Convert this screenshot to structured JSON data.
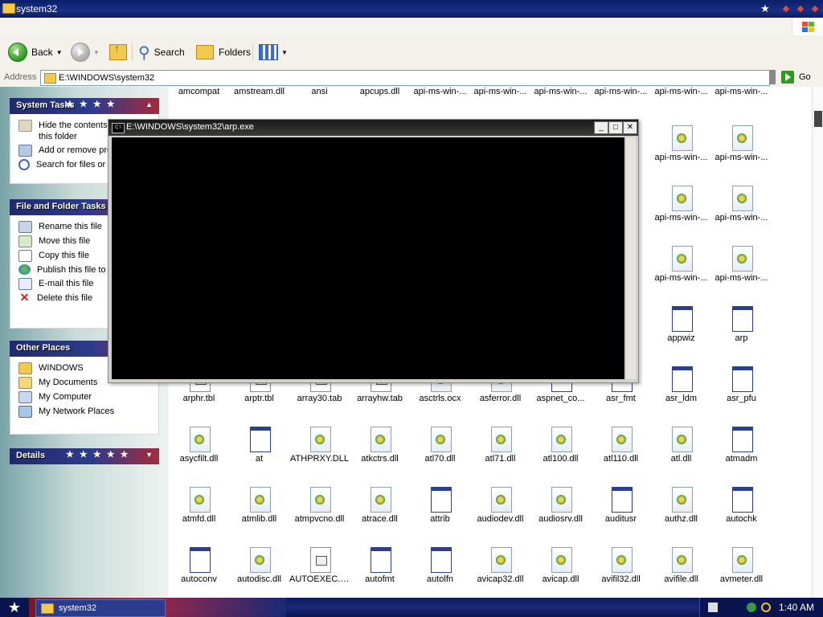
{
  "window": {
    "title": "system32",
    "path": "E:\\WINDOWS\\system32"
  },
  "toolbar": {
    "back": "Back",
    "search": "Search",
    "folders": "Folders"
  },
  "address": {
    "label": "Address",
    "value": "E:\\WINDOWS\\system32",
    "go": "Go"
  },
  "tasks": {
    "system": {
      "title": "System Tasks",
      "items": [
        "Hide the contents of this folder",
        "Add or remove programs",
        "Search for files or folders"
      ]
    },
    "file": {
      "title": "File and Folder Tasks",
      "items": [
        "Rename this file",
        "Move this file",
        "Copy this file",
        "Publish this file to the Web",
        "E-mail this file",
        "Delete this file"
      ]
    },
    "other": {
      "title": "Other Places",
      "items": [
        "WINDOWS",
        "My Documents",
        "My Computer",
        "My Network Places"
      ]
    },
    "details": {
      "title": "Details"
    }
  },
  "console": {
    "title": "E:\\WINDOWS\\system32\\arp.exe"
  },
  "files": {
    "row0": [
      "amcompat",
      "amstream.dll",
      "ansi",
      "apcups.dll",
      "api-ms-win-...",
      "api-ms-win-...",
      "api-ms-win-...",
      "api-ms-win-...",
      "api-ms-win-...",
      "api-ms-win-..."
    ],
    "col_right": [
      [
        "api-ms-win-...",
        "api-ms-win-..."
      ],
      [
        "api-ms-win-...",
        "api-ms-win-..."
      ],
      [
        "api-ms-win-...",
        "api-ms-win-..."
      ],
      [
        "appwiz",
        "arp"
      ]
    ],
    "row5": [
      "arphr.tbl",
      "arptr.tbl",
      "array30.tab",
      "arrayhw.tab",
      "asctrls.ocx",
      "asferror.dll",
      "aspnet_co...",
      "asr_fmt",
      "asr_ldm",
      "asr_pfu"
    ],
    "row6": [
      "asycfilt.dll",
      "at",
      "ATHPRXY.DLL",
      "atkctrs.dll",
      "atl70.dll",
      "atl71.dll",
      "atl100.dll",
      "atl110.dll",
      "atl.dll",
      "atmadm"
    ],
    "row7": [
      "atmfd.dll",
      "atmlib.dll",
      "atmpvcno.dll",
      "atrace.dll",
      "attrib",
      "audiodev.dll",
      "audiosrv.dll",
      "auditusr",
      "authz.dll",
      "autochk"
    ],
    "row8": [
      "autoconv",
      "autodisc.dll",
      "AUTOEXEC.NT",
      "autofmt",
      "autolfn",
      "avicap32.dll",
      "avicap.dll",
      "avifil32.dll",
      "avifile.dll",
      "avmeter.dll"
    ]
  },
  "taskbar": {
    "task": "system32",
    "clock": "1:40 AM"
  }
}
